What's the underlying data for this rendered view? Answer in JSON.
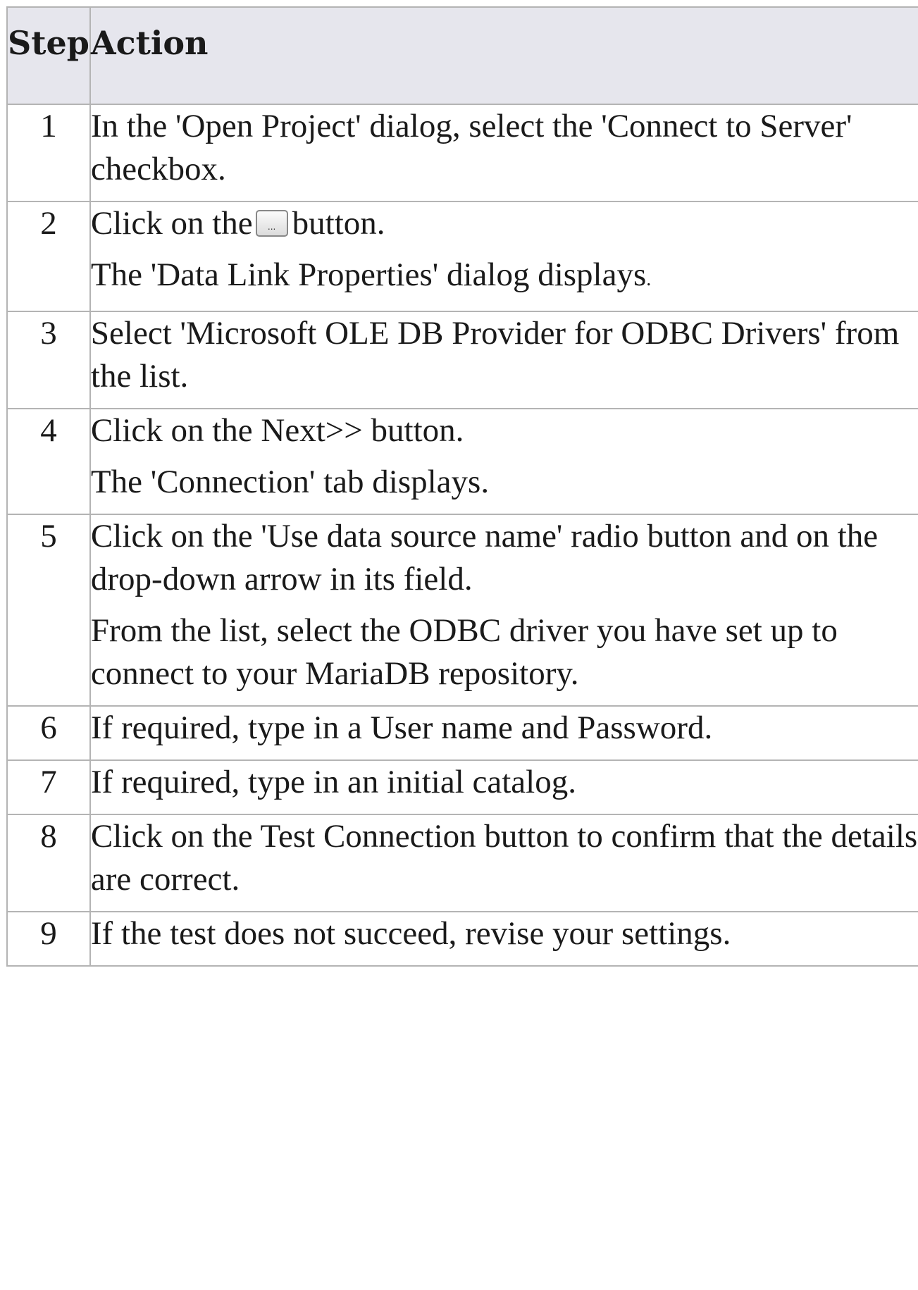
{
  "table": {
    "headers": {
      "step": "Step",
      "action": "Action"
    },
    "rows": [
      {
        "step": "1",
        "paragraphs": [
          "In the 'Open Project' dialog, select the 'Connect to Server' checkbox."
        ]
      },
      {
        "step": "2",
        "line1_before": "Click on the",
        "line1_after": "button.",
        "button_icon": "ellipsis-button-icon",
        "button_glyph": "...",
        "line2": "The 'Data Link Properties' dialog displays",
        "line2_end": "."
      },
      {
        "step": "3",
        "paragraphs": [
          "Select 'Microsoft OLE DB Provider for ODBC Drivers' from the list."
        ]
      },
      {
        "step": "4",
        "paragraphs": [
          "Click on the Next>> button.",
          "The 'Connection' tab displays."
        ]
      },
      {
        "step": "5",
        "paragraphs": [
          "Click on the 'Use data source name' radio button and on the drop-down arrow in its field.",
          "From the list, select the ODBC driver you have set up to connect to your MariaDB repository."
        ]
      },
      {
        "step": "6",
        "paragraphs": [
          "If required, type in a User name and Password."
        ]
      },
      {
        "step": "7",
        "paragraphs": [
          "If required, type in an initial catalog."
        ]
      },
      {
        "step": "8",
        "paragraphs": [
          "Click on the Test Connection button to confirm that the details are correct."
        ]
      },
      {
        "step": "9",
        "paragraphs": [
          "If the test does not succeed, revise your settings."
        ]
      }
    ]
  }
}
